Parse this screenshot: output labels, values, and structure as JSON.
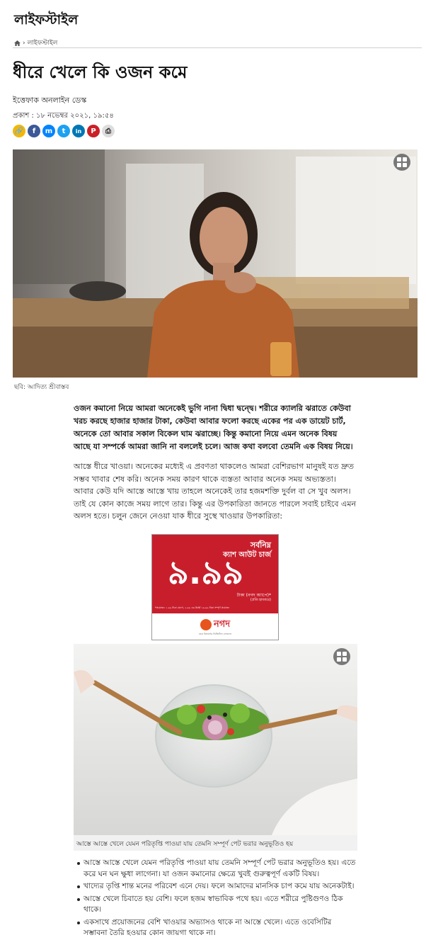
{
  "header": {
    "section": "লাইফস্টাইল"
  },
  "breadcrumb": {
    "current": "লাইফস্টাইল",
    "separator": "›"
  },
  "article": {
    "headline": "ধীরে খেলে কি ওজন কমে",
    "author": "ইত্তেফাক অনলাইন ডেস্ক",
    "published": "প্রকাশ : ১৮ নভেম্বর ২০২১, ১৯:৫৪",
    "hero_caption": "ছবি: আদিত্য শ্রীবাস্তব",
    "lead": "ওজন কমানো নিয়ে আমরা অনেকেই ভুগি নানা দ্বিধা দ্বন্দ্বে। শরীরে ক্যালরি ঝরাতে কেউবা খরচ করছে হাজার হাজার টাকা, কেউবা আবার ফলো করছে একের পর এক ডায়েট চার্ট, অনেকে তো আবার সকাল বিকেল ঘাম ঝরাচ্ছে। কিন্তু কমানো নিয়ে এমন অনেক বিষয় আছে যা সম্পর্কে আমরা জানি না বললেই চলে। আজ কথা বলবো তেমনি এক বিষয় নিয়ে।",
    "paragraph": "আস্তে ধীরে খাওয়া। অনেকের মধ্যেই এ প্রবণতা থাকলেও আমরা বেশিরভাগ মানুষই যত দ্রুত সম্ভব খাবার শেষ করি। অনেক সময় কারণ থাকে ব্যস্ততা আবার অনেক সময় অভ্যস্ততা। আবার কেউ যদি আস্তে আস্তে খায় তাহলে অনেকেই  তার হজমশক্তি দুর্বল বা সে খুব অলস। তাই যে কোন কাজে সময় লাগে তার। কিন্তু  এর উপকারিতা জানতে পারলে সবাই চাইবে এমন অলস হতে। চলুন জেনে নেওয়া যাক ধীরে সুস্থে খাওয়ার উপকারিতা:",
    "photo2_caption": "আস্তে আস্তে খেলে যেমন পরিতৃপ্তি পাওয়া যায় তেমনি সম্পূর্ণ পেট ভরার অনুভূতিও হয়",
    "bullets": [
      "আস্তে আস্তে খেলে যেমন পরিতৃপ্তি পাওয়া যায় তেমনি সম্পূর্ণ পেট ভরার অনুভূতিও হয়। এতে করে ঘন ঘন ক্ষুধা লাগেনা। যা ওজন কমানোর ক্ষেত্রে খুবই গুরুত্বপূর্ণ একটি বিষয়।",
      "খাদ্যের তৃপ্তি শান্ত মনের পরিবেশ এনে দেয়। ফলে আমাদের মানসিক চাপ কমে যায় অনেকটাই।",
      "আস্তে খেলে চিবাতে হয় বেশি। ফলে হজম স্বাভাবিক পথে হয়। এতে শরীরে পুষ্টিগুণও ঠিক থাকে।",
      "একসাথে প্রয়োজনের বেশি খাওয়ার অভ্যাসও থাকে না আস্তে খেলে। এতে ওবেসিটির সম্ভাবনা তৈরি হওয়ার কোন জায়গা থাকে না।"
    ]
  },
  "share_icons": [
    {
      "name": "link-icon",
      "glyph": "🔗",
      "color": "#f2b705"
    },
    {
      "name": "facebook-icon",
      "glyph": "f",
      "color": "#3b5998"
    },
    {
      "name": "messenger-icon",
      "glyph": "m",
      "color": "#0084ff"
    },
    {
      "name": "twitter-icon",
      "glyph": "t",
      "color": "#1da1f2"
    },
    {
      "name": "linkedin-icon",
      "glyph": "in",
      "color": "#0077b5"
    },
    {
      "name": "pinterest-icon",
      "glyph": "P",
      "color": "#cb2027"
    },
    {
      "name": "print-icon",
      "glyph": "⎙",
      "color": "#dddddd"
    }
  ],
  "ad": {
    "line1": "সর্বনিম্ন",
    "line2": "ক্যাশ আউট চার্জ",
    "amount": "৯.৯৯",
    "unit": "টাকা (নগদ অ্যাপে)*",
    "per": "(প্রতি হাজারে)",
    "fine": "*প্রযোজ্য: ১.৯৯ টাকা যোগে, ২.৯৯ এর উর্ধ্বে ১৯.৯৯ টাকা সম্পূর্ণ প্রযোজ্য",
    "brand": "নগদ",
    "brand_sub": "ডাক বিভাগের ডিজিটাল লেনদেন",
    "colors": {
      "red": "#c81e2c",
      "orange": "#e8541e"
    }
  }
}
